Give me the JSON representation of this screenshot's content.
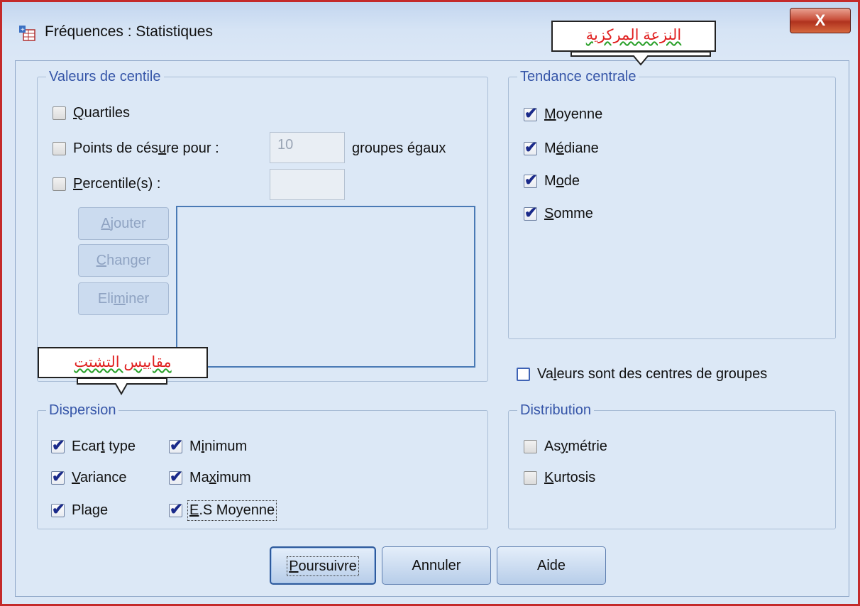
{
  "window": {
    "title": "Fréquences : Statistiques",
    "close_label": "X"
  },
  "centile": {
    "legend": "Valeurs de centile",
    "quartiles": {
      "pre": "",
      "u": "Q",
      "post": "uartiles",
      "checked": false
    },
    "cutpoints": {
      "pre": "Points de cés",
      "u": "u",
      "post": "re pour :",
      "checked": false
    },
    "cutpoints_value": "10",
    "cutpoints_suffix": "groupes égaux",
    "percentiles": {
      "pre": "",
      "u": "P",
      "post": "ercentile(s) :",
      "checked": false
    },
    "percentiles_value": "",
    "add_button": {
      "pre": "",
      "u": "A",
      "post": "jouter"
    },
    "change_button": {
      "pre": "",
      "u": "C",
      "post": "hanger"
    },
    "remove_button": {
      "pre": "Eli",
      "u": "m",
      "post": "iner"
    }
  },
  "central": {
    "legend": "Tendance centrale",
    "items": [
      {
        "pre": "",
        "u": "M",
        "post": "oyenne",
        "checked": true
      },
      {
        "pre": "M",
        "u": "é",
        "post": "diane",
        "checked": true
      },
      {
        "pre": "M",
        "u": "o",
        "post": "de",
        "checked": true
      },
      {
        "pre": "",
        "u": "S",
        "post": "omme",
        "checked": true
      }
    ]
  },
  "group_centers": {
    "pre": "Va",
    "u": "l",
    "post": "eurs sont des centres de groupes",
    "checked": false
  },
  "dispersion": {
    "legend": "Dispersion",
    "items": [
      {
        "pre": "Ecar",
        "u": "t",
        "post": " type",
        "checked": true
      },
      {
        "pre": "M",
        "u": "i",
        "post": "nimum",
        "checked": true
      },
      {
        "pre": "",
        "u": "V",
        "post": "ariance",
        "checked": true
      },
      {
        "pre": "Ma",
        "u": "x",
        "post": "imum",
        "checked": true
      },
      {
        "pre": "Pla",
        "u": "g",
        "post": "e",
        "checked": true
      },
      {
        "pre": "",
        "u": "E",
        "post": ".S Moyenne",
        "checked": true
      }
    ]
  },
  "distribution": {
    "legend": "Distribution",
    "items": [
      {
        "pre": "As",
        "u": "y",
        "post": "métrie",
        "checked": false
      },
      {
        "pre": "",
        "u": "K",
        "post": "urtosis",
        "checked": false
      }
    ]
  },
  "buttons": {
    "continue": {
      "pre": "",
      "u": "P",
      "post": "oursuivre"
    },
    "cancel": "Annuler",
    "help": "Aide"
  },
  "annotations": {
    "central": "النزعة المركزية",
    "dispersion": "مقاييس التشتت"
  },
  "icons": {
    "app": "spss-frequency-icon",
    "checkmark": "✔"
  },
  "colors": {
    "accent": "#3555a8",
    "close": "#c9513c",
    "annotation_text": "#e02020"
  }
}
